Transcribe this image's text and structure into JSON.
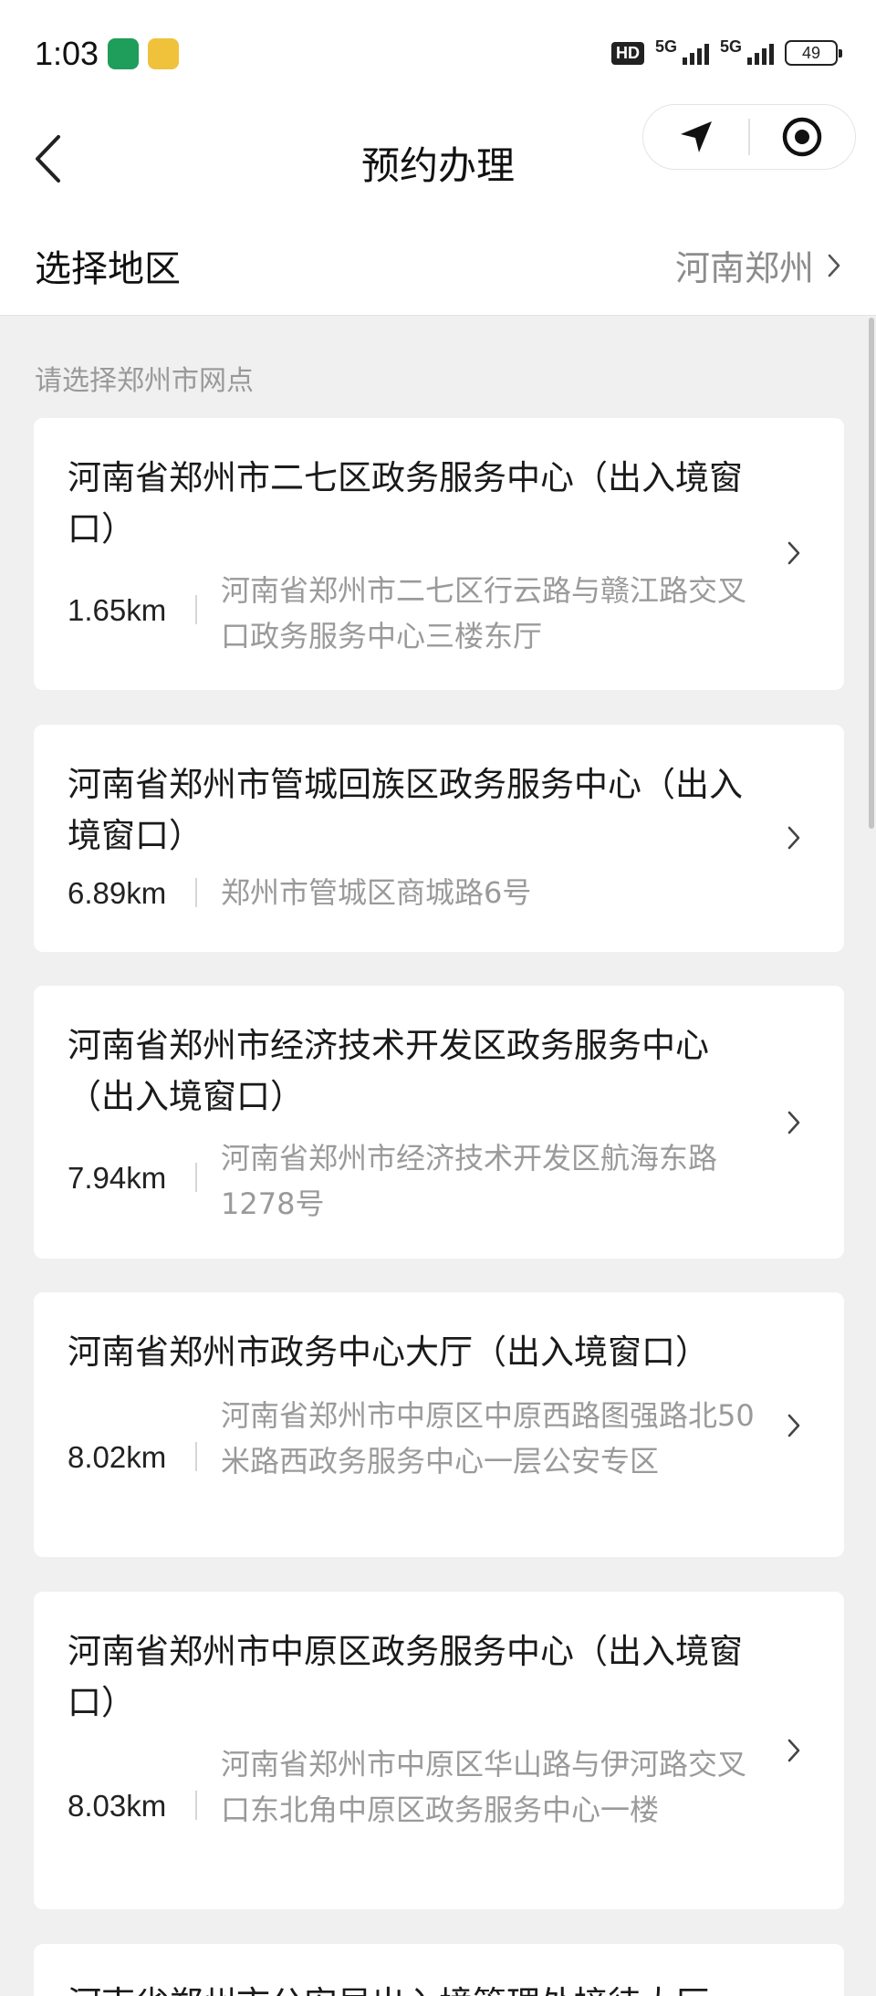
{
  "status_bar": {
    "time": "1:03",
    "hd_label": "HD",
    "network_1": "5G",
    "network_2": "5G",
    "battery": "49"
  },
  "nav": {
    "title": "预约办理"
  },
  "region": {
    "label": "选择地区",
    "value": "河南郑州"
  },
  "section_label": "请选择郑州市网点",
  "branches": [
    {
      "title": "河南省郑州市二七区政务服务中心（出入境窗口）",
      "distance": "1.65km",
      "address": "河南省郑州市二七区行云路与赣江路交叉口政务服务中心三楼东厅"
    },
    {
      "title": "河南省郑州市管城回族区政务服务中心（出入境窗口）",
      "distance": "6.89km",
      "address": "郑州市管城区商城路6号"
    },
    {
      "title": "河南省郑州市经济技术开发区政务服务中心（出入境窗口）",
      "distance": "7.94km",
      "address": "河南省郑州市经济技术开发区航海东路1278号"
    },
    {
      "title": "河南省郑州市政务中心大厅（出入境窗口）",
      "distance": "8.02km",
      "address": "河南省郑州市中原区中原西路图强路北50米路西政务服务中心一层公安专区"
    },
    {
      "title": "河南省郑州市中原区政务服务中心（出入境窗口）",
      "distance": "8.03km",
      "address": "河南省郑州市中原区华山路与伊河路交叉口东北角中原区政务服务中心一楼"
    },
    {
      "title": "河南省郑州市公安局出入境管理处接待大厅",
      "distance": "",
      "address": ""
    }
  ]
}
